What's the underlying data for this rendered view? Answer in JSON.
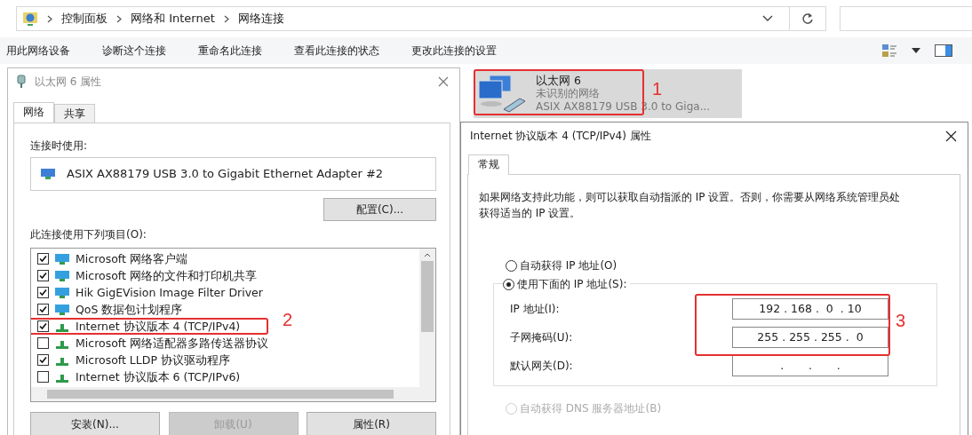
{
  "explorer": {
    "breadcrumbs": [
      "控制面板",
      "网络和 Internet",
      "网络连接"
    ],
    "commands": [
      "用此网络设备",
      "诊断这个连接",
      "重命名此连接",
      "查看此连接的状态",
      "更改此连接的设置"
    ],
    "connection": {
      "name": "以太网 6",
      "status": "未识别的网络",
      "device": "ASIX AX88179 USB 3.0 to Giga..."
    }
  },
  "properties_dialog": {
    "title": "以太网 6 属性",
    "tabs": [
      {
        "label": "网络",
        "selected": true
      },
      {
        "label": "共享",
        "selected": false
      }
    ],
    "connect_using_label": "连接时使用:",
    "adapter": "ASIX AX88179 USB 3.0 to Gigabit Ethernet Adapter #2",
    "configure_button": "配置(C)...",
    "items_label": "此连接使用下列项目(O):",
    "items": [
      {
        "label": "Microsoft 网络客户端",
        "checked": true,
        "kind": "client",
        "highlighted": false
      },
      {
        "label": "Microsoft 网络的文件和打印机共享",
        "checked": true,
        "kind": "client",
        "highlighted": false
      },
      {
        "label": "Hik GigEVision Image Filter Driver",
        "checked": true,
        "kind": "client",
        "highlighted": false
      },
      {
        "label": "QoS 数据包计划程序",
        "checked": true,
        "kind": "client",
        "highlighted": false
      },
      {
        "label": "Internet 协议版本 4 (TCP/IPv4)",
        "checked": true,
        "kind": "protocol",
        "highlighted": true
      },
      {
        "label": "Microsoft 网络适配器多路传送器协议",
        "checked": false,
        "kind": "protocol",
        "highlighted": false
      },
      {
        "label": "Microsoft LLDP 协议驱动程序",
        "checked": true,
        "kind": "protocol",
        "highlighted": false
      },
      {
        "label": "Internet 协议版本 6 (TCP/IPv6)",
        "checked": false,
        "kind": "protocol",
        "highlighted": false
      }
    ],
    "buttons": [
      {
        "label": "安装(N)...",
        "disabled": false
      },
      {
        "label": "卸载(U)",
        "disabled": true
      },
      {
        "label": "属性(R)",
        "disabled": false
      }
    ]
  },
  "ipv4_dialog": {
    "title": "Internet 协议版本 4 (TCP/IPv4) 属性",
    "tabs": [
      {
        "label": "常规",
        "selected": true
      }
    ],
    "description": "如果网络支持此功能，则可以获取自动指派的 IP 设置。否则，你需要从网络系统管理员处获得适当的 IP 设置。",
    "ip_options": [
      {
        "label": "自动获得 IP 地址(O)",
        "selected": false
      },
      {
        "label": "使用下面的 IP 地址(S):",
        "selected": true
      }
    ],
    "fields": [
      {
        "label": "IP 地址(I):",
        "value": "192 . 168 .  0  . 10"
      },
      {
        "label": "子网掩码(U):",
        "value": "255 . 255 . 255 .  0"
      },
      {
        "label": "默认网关(D):",
        "value": ".       .       ."
      }
    ],
    "dns_options": [
      {
        "label": "自动获得 DNS 服务器地址(B)",
        "selected": false,
        "disabled": true
      }
    ]
  },
  "annotations": [
    "1",
    "2",
    "3"
  ]
}
